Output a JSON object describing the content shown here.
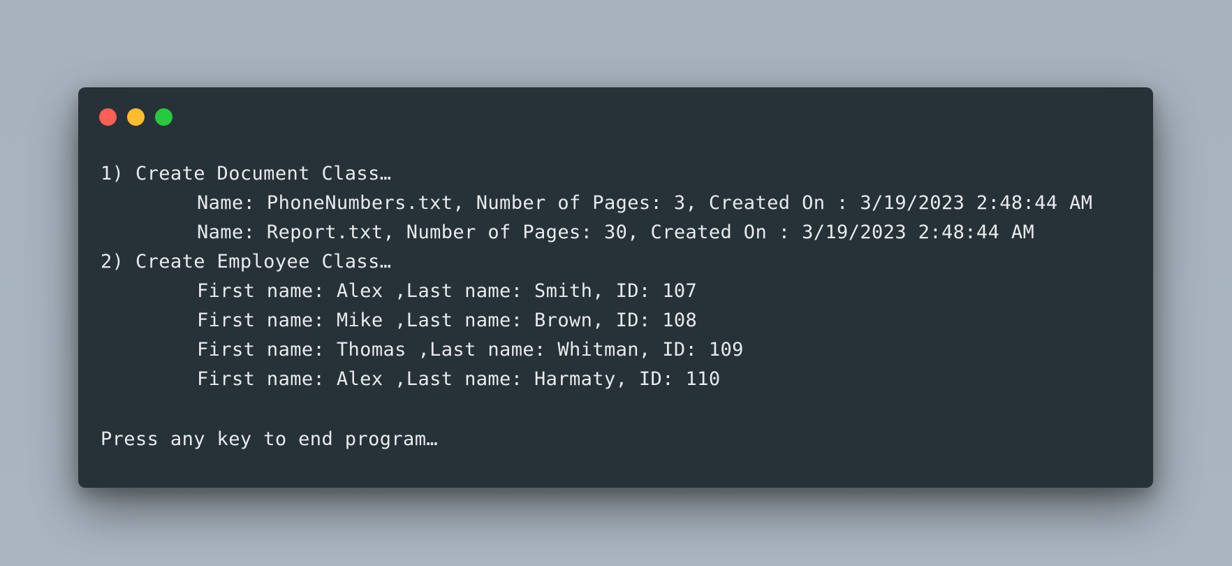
{
  "window": {
    "traffic_lights": {
      "close_color": "#ff5f56",
      "minimize_color": "#ffbd2e",
      "maximize_color": "#27c93f"
    }
  },
  "terminal": {
    "colors": {
      "background": "#263238",
      "text": "#e8eaed"
    },
    "lines": {
      "heading_1": "1) Create Document Class…",
      "doc_1": "Name: PhoneNumbers.txt, Number of Pages: 3, Created On : 3/19/2023 2:48:44 AM",
      "doc_2": "Name: Report.txt, Number of Pages: 30, Created On : 3/19/2023 2:48:44 AM",
      "heading_2": "2) Create Employee Class…",
      "emp_1": "First name: Alex ,Last name: Smith, ID: 107",
      "emp_2": "First name: Mike ,Last name: Brown, ID: 108",
      "emp_3": "First name: Thomas ,Last name: Whitman, ID: 109",
      "emp_4": "First name: Alex ,Last name: Harmaty, ID: 110",
      "prompt": "Press any key to end program…"
    }
  }
}
